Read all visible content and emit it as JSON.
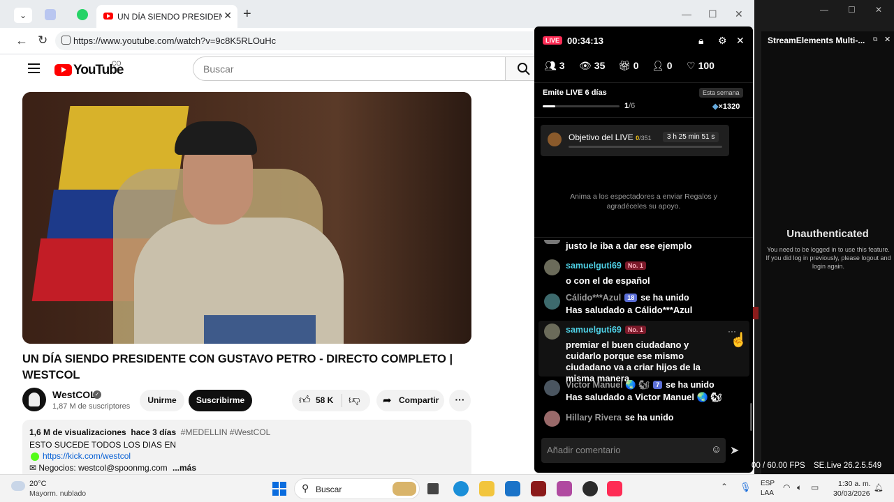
{
  "browser": {
    "tab_title": "UN DÍA SIENDO PRESIDENTE CON GUSTAVO PETRO",
    "tab_close": "✕",
    "new_tab": "+",
    "url": "https://www.youtube.com/watch?v=9c8K5RLOuHc",
    "window_controls": [
      "—",
      "☐",
      "✕"
    ]
  },
  "youtube": {
    "logo_text": "YouTube",
    "country": "CO",
    "search_placeholder": "Buscar",
    "video_title": "UN DÍA SIENDO PRESIDENTE CON GUSTAVO PETRO - DIRECTO COMPLETO | WESTCOL",
    "channel_name": "WestCOL",
    "subscribers": "1,87 M de suscriptores",
    "join_label": "Unirme",
    "subscribe_label": "Suscribirme",
    "like_count": "58 K",
    "share_label": "Compartir",
    "more_label": "···",
    "description": {
      "views": "1,6 M de visualizaciones",
      "date": "hace 3 días",
      "tags": "#MEDELLIN #WestCOL",
      "line1": "ESTO SUCEDE TODOS LOS DIAS EN",
      "link": "https://kick.com/westcol",
      "business": "✉ Negocios: westcol@spoonmg.com",
      "more": "...más"
    }
  },
  "live_panel": {
    "badge": "LIVE",
    "timer": "00:34:13",
    "stats": {
      "viewers_now": "3",
      "views": "35",
      "gifts": "0",
      "new_followers": "0",
      "likes": "100"
    },
    "weekly": {
      "title": "Emite LIVE 6 días",
      "badge": "Esta semana",
      "progress_current": "1",
      "progress_total": "/6",
      "progress_fraction": 0.167,
      "bonus": "×1320"
    },
    "goal": {
      "label": "Objetivo del LIVE",
      "current": "0",
      "total": "/351",
      "timer": "3 h 25 min 51 s",
      "progress_fraction": 0.0
    },
    "hint": "Anima a los espectadores a enviar Regalos y agradéceles su apoyo.",
    "messages": [
      {
        "user": "",
        "text": "justo le iba a dar ese ejemplo"
      },
      {
        "user": "samuelguti69",
        "badge": "No. 1",
        "text": "o con el de español"
      },
      {
        "user": "Cálido***Azul",
        "level": "18",
        "joined": "se ha unido",
        "text": "Has saludado a Cálido***Azul"
      },
      {
        "user": "samuelguti69",
        "badge": "No. 1",
        "text": "premiar el buen ciudadano y cuidarlo porque ese mismo ciudadano va a criar hijos de la misma manera"
      },
      {
        "user": "Victor Manuel 🌏 🐿",
        "level": "7",
        "joined": "se ha unido",
        "text": "Has saludado a Victor Manuel 🌏 🐿"
      },
      {
        "user": "Hillary Rivera",
        "joined": "se ha unido"
      }
    ],
    "comment_placeholder": "Añadir comentario"
  },
  "streamelements": {
    "title": "StreamElements Multi-...",
    "heading": "Unauthenticated",
    "message": "You need to be logged in to use this feature. If you did log in previously, please logout and login again.",
    "fps": "00 / 60.00 FPS",
    "version": "SE.Live 26.2.5.549"
  },
  "taskbar": {
    "temperature": "20°C",
    "weather": "Mayorm. nublado",
    "search_label": "Buscar",
    "lang1": "ESP",
    "lang2": "LAA",
    "time": "1:30 a. m.",
    "date": "30/03/2026"
  },
  "colors": {
    "youtube_red": "#ff0000",
    "live_pink": "#fe2c55",
    "chat_username": "#4fd1e6",
    "goal_yellow": "#f5c518"
  }
}
